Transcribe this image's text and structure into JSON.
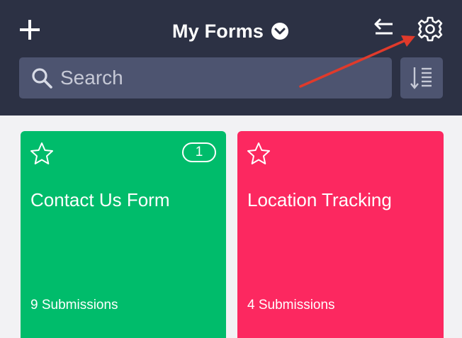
{
  "header": {
    "title": "My Forms",
    "add_icon": "plus-icon",
    "title_dropdown_icon": "chevron-down-circle-icon",
    "swap_icon": "swap-arrows-icon",
    "settings_icon": "gear-icon",
    "background_color": "#2c3144"
  },
  "search": {
    "placeholder": "Search",
    "value": "",
    "icon": "search-icon",
    "sort_icon": "sort-list-icon"
  },
  "cards": [
    {
      "title": "Contact Us Form",
      "submissions": "9 Submissions",
      "badge": "1",
      "color": "#00bc6b",
      "star_icon": "star-outline-icon"
    },
    {
      "title": "Location Tracking",
      "submissions": "4 Submissions",
      "color": "#fc2860",
      "star_icon": "star-outline-icon"
    }
  ],
  "annotation": {
    "arrow_color": "#e03a2b",
    "points_to": "gear-icon"
  }
}
